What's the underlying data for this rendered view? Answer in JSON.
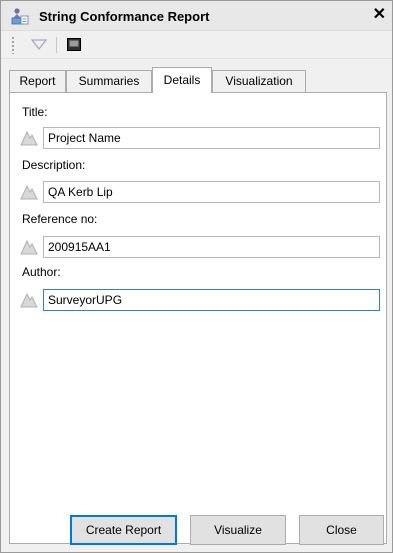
{
  "window": {
    "title": "String Conformance Report",
    "close_glyph": "✕",
    "app_icon": "report-app-icon"
  },
  "toolbar": {
    "filter_icon": "filter-triangle-icon",
    "monitor_icon": "monitor-icon"
  },
  "tabs": [
    {
      "label": "Report",
      "active": false
    },
    {
      "label": "Summaries",
      "active": false
    },
    {
      "label": "Details",
      "active": true
    },
    {
      "label": "Visualization",
      "active": false
    }
  ],
  "details": {
    "title": {
      "label": "Title:",
      "value": "Project Name"
    },
    "description": {
      "label": "Description:",
      "value": "QA Kerb Lip"
    },
    "reference": {
      "label": "Reference no:",
      "value": "200915AA1"
    },
    "author": {
      "label": "Author:",
      "value": "SurveyorUPG"
    }
  },
  "buttons": {
    "create_report": "Create Report",
    "visualize": "Visualize",
    "close": "Close"
  },
  "colors": {
    "focus_border": "#3c7fb1",
    "default_button_border": "#0078d7"
  }
}
